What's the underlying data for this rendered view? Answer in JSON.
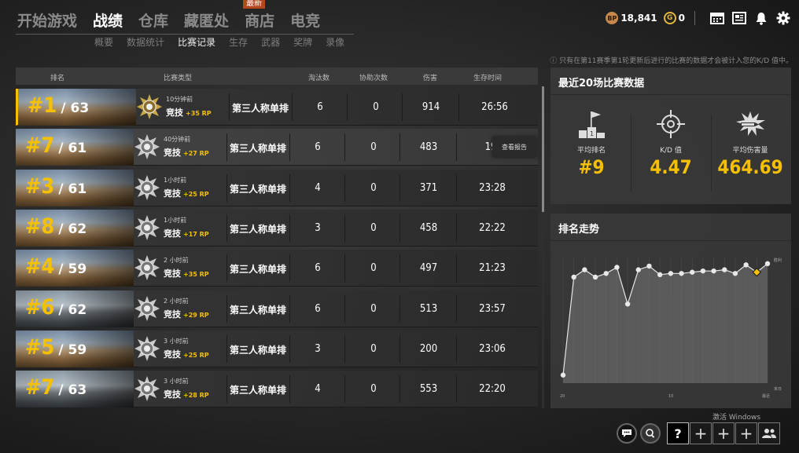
{
  "nav": {
    "items": [
      {
        "label": "开始游戏",
        "active": false
      },
      {
        "label": "战绩",
        "active": true
      },
      {
        "label": "仓库",
        "active": false
      },
      {
        "label": "藏匿处",
        "active": false
      },
      {
        "label": "商店",
        "active": false
      },
      {
        "label": "电竞",
        "active": false
      }
    ],
    "new_badge": "最新",
    "subnav": [
      {
        "label": "概要",
        "active": false
      },
      {
        "label": "数据统计",
        "active": false
      },
      {
        "label": "比赛记录",
        "active": true
      },
      {
        "label": "生存",
        "active": false
      },
      {
        "label": "武器",
        "active": false
      },
      {
        "label": "奖牌",
        "active": false
      },
      {
        "label": "录像",
        "active": false
      }
    ]
  },
  "currency": {
    "bp_icon": "BP",
    "bp_value": "18,841",
    "g_icon": "G",
    "g_value": "0"
  },
  "notice": "ⓘ 只有在第11赛季第1轮更新后进行的比赛的数据才会被计入您的K/D 值中。",
  "table": {
    "headers": {
      "rank": "排名",
      "match_type": "比赛类型",
      "kills": "淘汰数",
      "assists": "协助次数",
      "damage": "伤害",
      "survival": "生存时间"
    },
    "report_label": "查看报告",
    "rows": [
      {
        "rank": "#1",
        "total": "/ 63",
        "map": "desert",
        "ago": "10分钟前",
        "mode": "竞技",
        "rp": "+35 RP",
        "type": "第三人称单排",
        "kills": "6",
        "assists": "0",
        "damage": "914",
        "time": "26:56"
      },
      {
        "rank": "#7",
        "total": "/ 61",
        "map": "desert",
        "ago": "40分钟前",
        "mode": "竞技",
        "rp": "+27 RP",
        "type": "第三人称单排",
        "kills": "6",
        "assists": "0",
        "damage": "483",
        "time": "19:"
      },
      {
        "rank": "#3",
        "total": "/ 61",
        "map": "desert",
        "ago": "1小时前",
        "mode": "竞技",
        "rp": "+25 RP",
        "type": "第三人称单排",
        "kills": "4",
        "assists": "0",
        "damage": "371",
        "time": "23:28"
      },
      {
        "rank": "#8",
        "total": "/ 62",
        "map": "desert",
        "ago": "1小时前",
        "mode": "竞技",
        "rp": "+17 RP",
        "type": "第三人称单排",
        "kills": "3",
        "assists": "0",
        "damage": "458",
        "time": "22:22"
      },
      {
        "rank": "#4",
        "total": "/ 59",
        "map": "desert",
        "ago": "2 小时前",
        "mode": "竞技",
        "rp": "+35 RP",
        "type": "第三人称单排",
        "kills": "6",
        "assists": "0",
        "damage": "497",
        "time": "21:23"
      },
      {
        "rank": "#6",
        "total": "/ 62",
        "map": "snow",
        "ago": "2 小时前",
        "mode": "竞技",
        "rp": "+29 RP",
        "type": "第三人称单排",
        "kills": "6",
        "assists": "0",
        "damage": "513",
        "time": "23:57"
      },
      {
        "rank": "#5",
        "total": "/ 59",
        "map": "desert",
        "ago": "3 小时前",
        "mode": "竞技",
        "rp": "+25 RP",
        "type": "第三人称单排",
        "kills": "3",
        "assists": "0",
        "damage": "200",
        "time": "23:06"
      },
      {
        "rank": "#7",
        "total": "/ 63",
        "map": "snow",
        "ago": "3 小时前",
        "mode": "竞技",
        "rp": "+28 RP",
        "type": "第三人称单排",
        "kills": "4",
        "assists": "0",
        "damage": "553",
        "time": "22:20"
      }
    ]
  },
  "summary": {
    "title": "最近20场比赛数据",
    "avg_rank_label": "平均排名",
    "avg_rank": "#9",
    "kd_label": "K/D 值",
    "kd": "4.47",
    "avg_damage_label": "平均伤害量",
    "avg_damage": "464.69"
  },
  "trend": {
    "title": "排名走势",
    "y_top_label": "胜利",
    "y_bottom_label": "末日",
    "x_labels": [
      "20",
      "10",
      "最近"
    ]
  },
  "chart_data": {
    "type": "line",
    "title": "排名走势",
    "series": [
      {
        "values": [
          0.04,
          0.84,
          0.9,
          0.84,
          0.87,
          0.92,
          0.62,
          0.9,
          0.93,
          0.86,
          0.87,
          0.87,
          0.88,
          0.89,
          0.89,
          0.9,
          0.87,
          0.94,
          0.88,
          0.95
        ]
      }
    ],
    "highlight_index": 18,
    "ylim": [
      0,
      1
    ]
  },
  "system": {
    "activate_windows": "激活 Windows",
    "help_slot": "?",
    "empty_slot": "+"
  }
}
